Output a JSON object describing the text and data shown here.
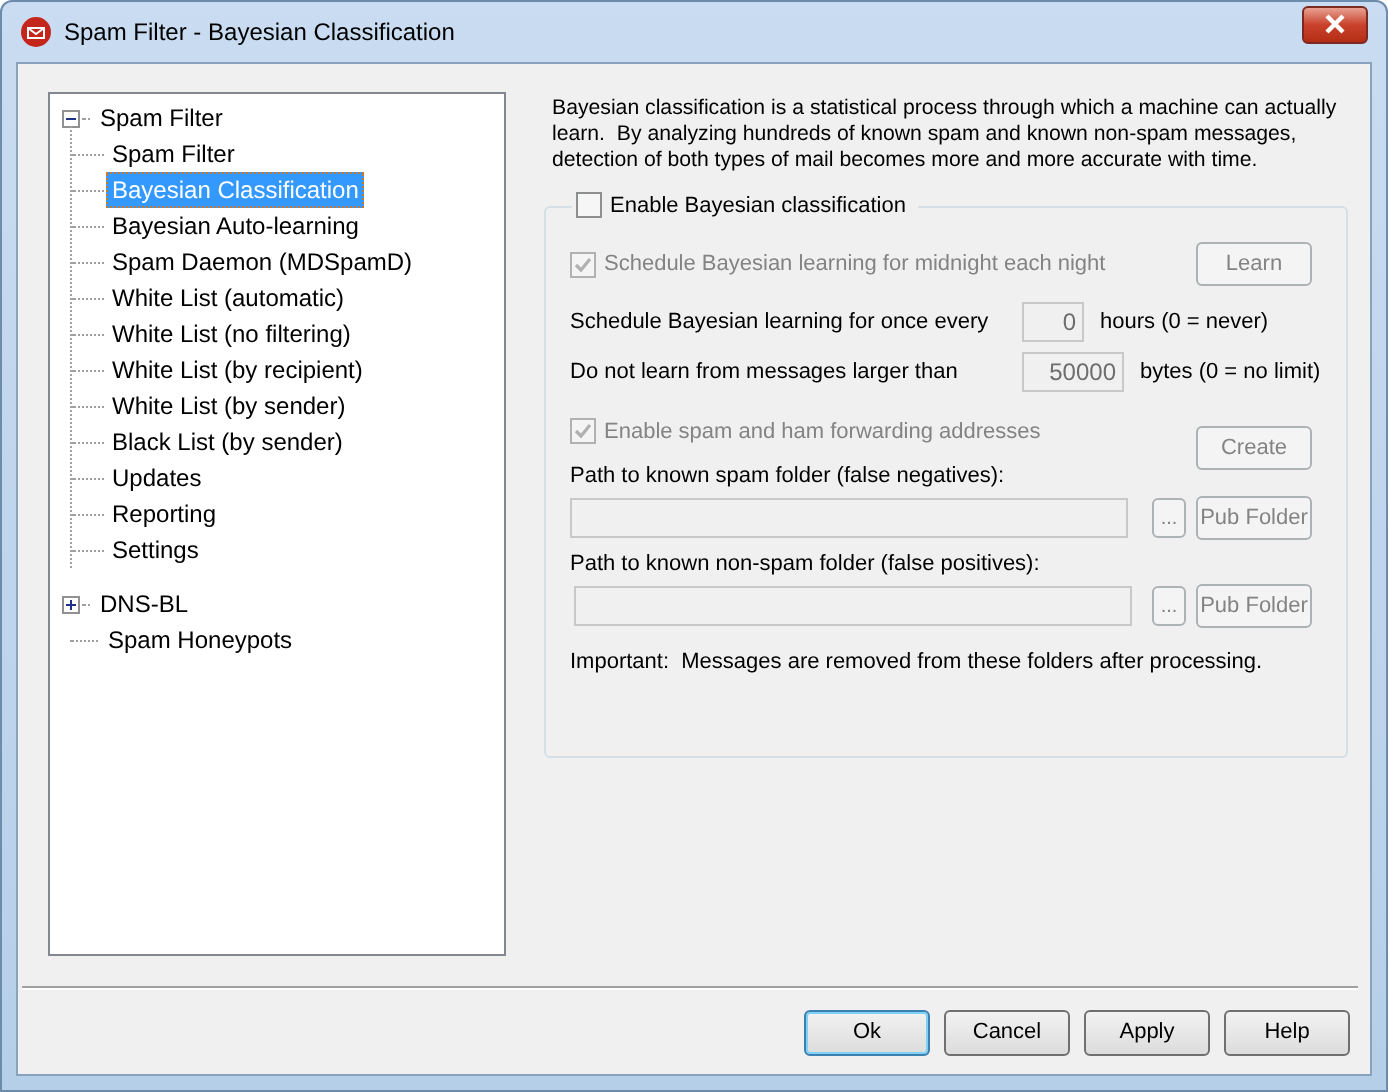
{
  "window": {
    "title": "Spam Filter - Bayesian Classification"
  },
  "tree": [
    {
      "label": "Spam Filter",
      "expanded": true,
      "selected": false,
      "children": [
        {
          "label": "Spam Filter",
          "selected": false
        },
        {
          "label": "Bayesian Classification",
          "selected": true
        },
        {
          "label": "Bayesian Auto-learning",
          "selected": false
        },
        {
          "label": "Spam Daemon (MDSpamD)",
          "selected": false
        },
        {
          "label": "White List (automatic)",
          "selected": false
        },
        {
          "label": "White List (no filtering)",
          "selected": false
        },
        {
          "label": "White List (by recipient)",
          "selected": false
        },
        {
          "label": "White List (by sender)",
          "selected": false
        },
        {
          "label": "Black List (by sender)",
          "selected": false
        },
        {
          "label": "Updates",
          "selected": false
        },
        {
          "label": "Reporting",
          "selected": false
        },
        {
          "label": "Settings",
          "selected": false
        }
      ]
    },
    {
      "label": "DNS-BL",
      "expanded": false,
      "selected": false
    },
    {
      "label": "Spam Honeypots",
      "selected": false
    }
  ],
  "description": "Bayesian classification is a statistical process through which a machine can actually learn.  By analyzing hundreds of known spam and known non-spam messages, detection of both types of mail becomes more and more accurate with time.",
  "enable_checkbox": {
    "label": "Enable Bayesian classification",
    "checked": false,
    "disabled": false
  },
  "schedule_midnight": {
    "label": "Schedule Bayesian learning for midnight each night",
    "checked": true,
    "disabled": true
  },
  "learn_button": {
    "label": "Learn",
    "disabled": true
  },
  "interval": {
    "label": "Schedule Bayesian learning for once every",
    "value": "0",
    "unit": "hours (0 = never)",
    "disabled": true
  },
  "size_limit": {
    "label": "Do not learn from messages larger than",
    "value": "50000",
    "unit": "bytes (0 = no limit)",
    "disabled": true
  },
  "forwarding": {
    "label": "Enable spam and ham forwarding addresses",
    "checked": true,
    "disabled": true
  },
  "create_button": {
    "label": "Create",
    "disabled": true
  },
  "folders": [
    {
      "label": "Path to known spam folder (false negatives):",
      "browse": "...",
      "pub_folder": "Pub Folder",
      "disabled": true
    },
    {
      "label": "Path to known non-spam folder (false positives):",
      "browse": "...",
      "pub_folder": "Pub Folder",
      "disabled": true
    }
  ],
  "note": "Important:  Messages are removed from these folders after processing.",
  "buttons": [
    {
      "label": "Ok",
      "default": true
    },
    {
      "label": "Cancel",
      "default": false
    },
    {
      "label": "Apply",
      "default": false
    },
    {
      "label": "Help",
      "default": false
    }
  ]
}
